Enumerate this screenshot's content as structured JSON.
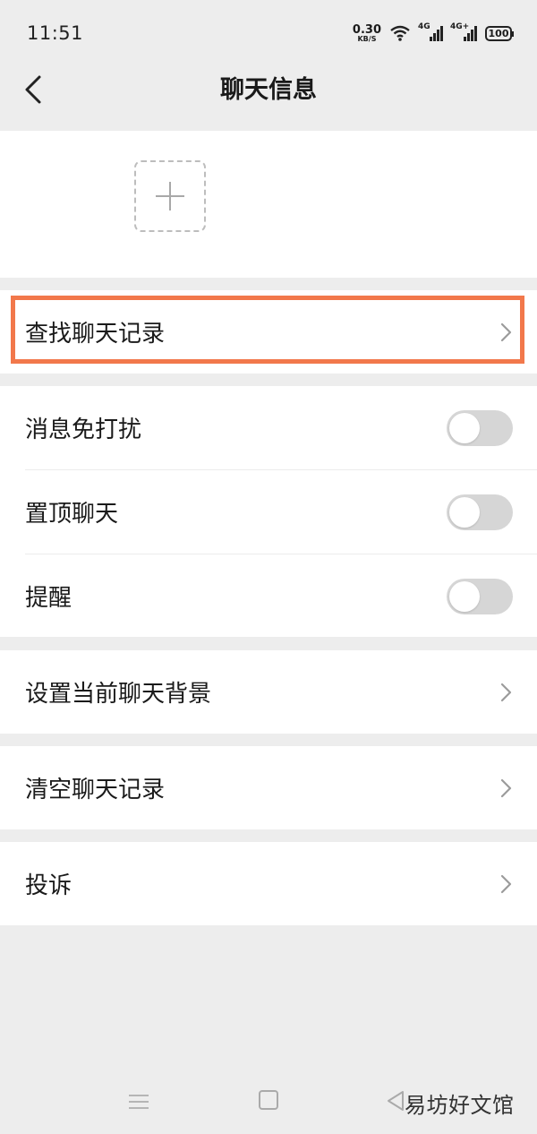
{
  "status_bar": {
    "time": "11:51",
    "net_speed_value": "0.30",
    "net_speed_unit": "KB/S",
    "signal_1_label": "4G",
    "signal_2_label": "4G+",
    "battery": "100"
  },
  "header": {
    "title": "聊天信息",
    "back_icon": "chevron-left-icon"
  },
  "members": {
    "add_icon": "plus-icon"
  },
  "menu": {
    "search_history": "查找聊天记录",
    "mute": "消息免打扰",
    "pin": "置顶聊天",
    "reminder": "提醒",
    "set_background": "设置当前聊天背景",
    "clear_history": "清空聊天记录",
    "report": "投诉"
  },
  "toggles": {
    "mute_on": false,
    "pin_on": false,
    "reminder_on": false
  },
  "colors": {
    "highlight_border": "#f2784b",
    "toggle_off": "#d6d6d6",
    "background": "#ededed"
  },
  "watermark": "易坊好文馆"
}
